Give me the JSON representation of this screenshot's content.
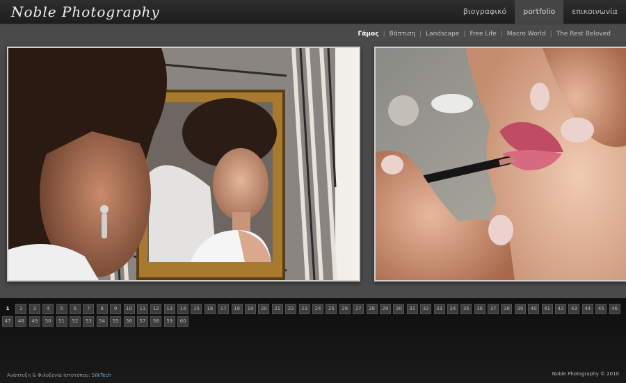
{
  "header": {
    "logo": "Noble Photography",
    "nav": [
      {
        "label": "βιογραφικό",
        "active": false
      },
      {
        "label": "portfolio",
        "active": true
      },
      {
        "label": "επικοινωνία",
        "active": false
      }
    ]
  },
  "subnav": {
    "items": [
      {
        "label": "Γάμος",
        "active": true
      },
      {
        "label": "Βάπτιση",
        "active": false
      },
      {
        "label": "Landscape",
        "active": false
      },
      {
        "label": "Free Life",
        "active": false
      },
      {
        "label": "Macro World",
        "active": false
      },
      {
        "label": "The Rest Beloved",
        "active": false
      }
    ],
    "separator": "|"
  },
  "gallery": {
    "photos": [
      {
        "name": "bride-in-mirror-photo"
      },
      {
        "name": "lipstick-application-photo"
      }
    ]
  },
  "pagination": {
    "total": 60,
    "current": 1
  },
  "footer": {
    "credit_prefix": "Ανάπτυξη & Φιλοξενία Ιστοτόπου:",
    "credit_link": "SilkTech",
    "copyright": "Noble Photography © 2010"
  },
  "colors": {
    "panel": "#4a4a4a",
    "accent_link": "#6fb0e6",
    "background": "#141414"
  }
}
